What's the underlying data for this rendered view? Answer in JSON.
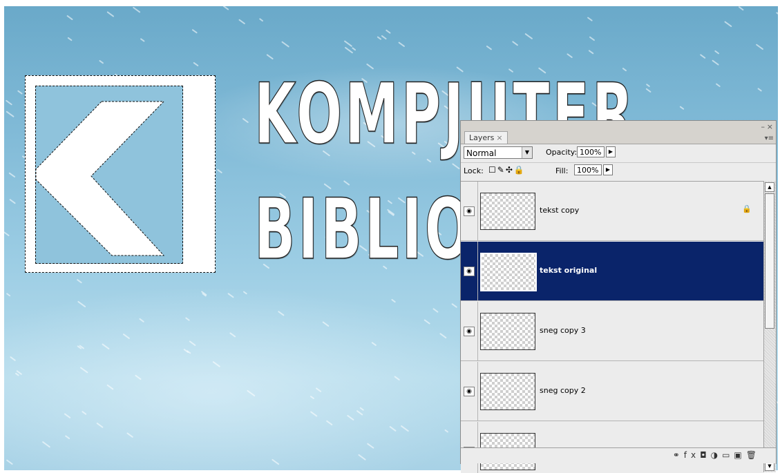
{
  "canvas": {
    "word_line1": "KOMPJUTER",
    "word_line2": "BIBLIO"
  },
  "layers_panel": {
    "tab_label": "Layers",
    "tab_close": "×",
    "minimize_glyph": "–",
    "close_glyph": "×",
    "menu_glyph": "▾≡",
    "blend_mode": "Normal",
    "opacity_label": "Opacity:",
    "opacity_value": "100%",
    "lock_label": "Lock:",
    "lock_icons": "☐✎✣🔒",
    "fill_label": "Fill:",
    "fill_value": "100%",
    "layers": [
      {
        "name": "tekst copy",
        "locked": true,
        "selected": false
      },
      {
        "name": "tekst original",
        "locked": false,
        "selected": true
      },
      {
        "name": "sneg copy 3",
        "locked": false,
        "selected": false
      },
      {
        "name": "sneg copy 2",
        "locked": false,
        "selected": false
      },
      {
        "name": "",
        "locked": false,
        "selected": false
      }
    ],
    "lock_badge": "🔒",
    "eye_glyph": "◉",
    "footer_icons": [
      "link-icon",
      "fx-icon",
      "mask-icon",
      "adjustment-icon",
      "group-icon",
      "new-layer-icon",
      "trash-icon"
    ],
    "footer_glyphs": [
      "⚭",
      "fx",
      "◘",
      "◑",
      "▭",
      "▣",
      "🗑"
    ],
    "selected_color": "#0a246a"
  }
}
